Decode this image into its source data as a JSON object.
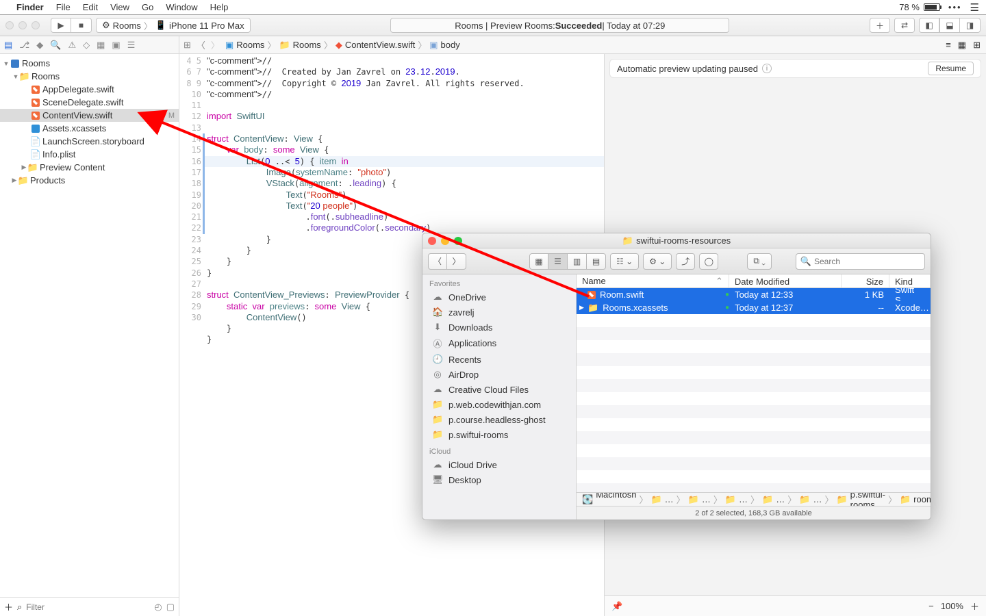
{
  "menubar": {
    "app": "Finder",
    "items": [
      "File",
      "Edit",
      "View",
      "Go",
      "Window",
      "Help"
    ],
    "battery": "78 %"
  },
  "toolbar": {
    "scheme_app": "Rooms",
    "scheme_device": "iPhone 11 Pro Max",
    "status_prefix": "Rooms | Preview Rooms: ",
    "status_state": "Succeeded",
    "status_time": " | Today at 07:29"
  },
  "breadcrumb": [
    "Rooms",
    "Rooms",
    "ContentView.swift",
    "body"
  ],
  "navigator": {
    "root": "Rooms",
    "group": "Rooms",
    "files": [
      "AppDelegate.swift",
      "SceneDelegate.swift",
      "ContentView.swift",
      "Assets.xcassets",
      "LaunchScreen.storyboard",
      "Info.plist"
    ],
    "selected": "ContentView.swift",
    "badge": "M",
    "folders": [
      "Preview Content",
      "Products"
    ],
    "filter_placeholder": "Filter"
  },
  "editor": {
    "first_line": 4,
    "lines": [
      "//",
      "//  Created by Jan Zavrel on 23.12.2019.",
      "//  Copyright © 2019 Jan Zavrel. All rights reserved.",
      "//",
      "",
      "import SwiftUI",
      "",
      "struct ContentView: View {",
      "    var body: some View {",
      "        List(0 ..< 5) { item in",
      "            Image(systemName: \"photo\")",
      "            VStack(alignment: .leading) {",
      "                Text(\"Rooms\")",
      "                Text(\"20 people\")",
      "                    .font(.subheadline)",
      "                    .foregroundColor(.secondary)",
      "            }",
      "        }",
      "    }",
      "}",
      "",
      "struct ContentView_Previews: PreviewProvider {",
      "    static var previews: some View {",
      "        ContentView()",
      "    }",
      "}",
      ""
    ],
    "highlight_line": 13
  },
  "canvas": {
    "msg": "Automatic preview updating paused",
    "resume": "Resume",
    "zoom": "100%"
  },
  "finder": {
    "title": "swiftui-rooms-resources",
    "search_placeholder": "Search",
    "favorites_header": "Favorites",
    "favorites": [
      "OneDrive",
      "zavrelj",
      "Downloads",
      "Applications",
      "Recents",
      "AirDrop",
      "Creative Cloud Files",
      "p.web.codewithjan.com",
      "p.course.headless-ghost",
      "p.swiftui-rooms"
    ],
    "icloud_header": "iCloud",
    "icloud": [
      "iCloud Drive",
      "Desktop"
    ],
    "columns": {
      "name": "Name",
      "date": "Date Modified",
      "size": "Size",
      "kind": "Kind"
    },
    "rows": [
      {
        "name": "Room.swift",
        "date": "Today at 12:33",
        "size": "1 KB",
        "kind": "Swift S…",
        "icon": "swift"
      },
      {
        "name": "Rooms.xcassets",
        "date": "Today at 12:37",
        "size": "--",
        "kind": "Xcode…",
        "icon": "folder"
      }
    ],
    "path": [
      "Macintosh …",
      "…",
      "…",
      "…",
      "…",
      "…",
      "p.swiftui-rooms",
      "swiftui-rooms-resources"
    ],
    "status": "2 of 2 selected, 168,3 GB available"
  }
}
